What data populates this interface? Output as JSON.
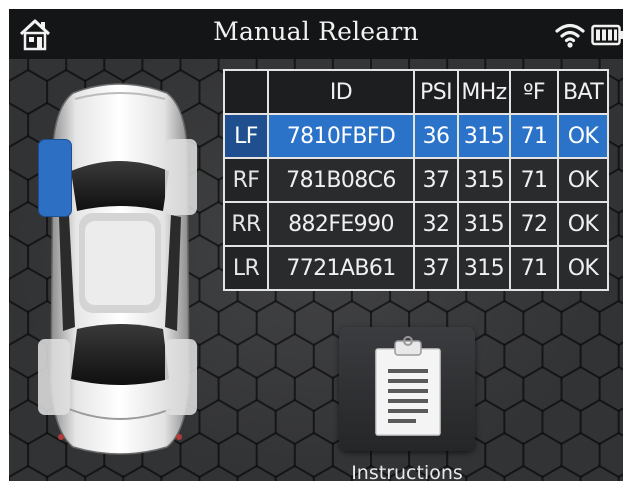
{
  "header": {
    "title": "Manual Relearn",
    "home_icon": "home-icon",
    "wifi_icon": "wifi-icon",
    "battery_icon": "battery-icon"
  },
  "car": {
    "icon": "car-top-view-icon",
    "selected_tire": "LF"
  },
  "sensor_table": {
    "headers": [
      "",
      "ID",
      "PSI",
      "MHz",
      "ºF",
      "BAT"
    ],
    "rows": [
      {
        "pos": "LF",
        "id": "7810FBFD",
        "psi": "36",
        "mhz": "315",
        "temp": "71",
        "bat": "OK"
      },
      {
        "pos": "RF",
        "id": "781B08C6",
        "psi": "37",
        "mhz": "315",
        "temp": "71",
        "bat": "OK"
      },
      {
        "pos": "RR",
        "id": "882FE990",
        "psi": "32",
        "mhz": "315",
        "temp": "72",
        "bat": "OK"
      },
      {
        "pos": "LR",
        "id": "7721AB61",
        "psi": "37",
        "mhz": "315",
        "temp": "71",
        "bat": "OK"
      }
    ]
  },
  "instructions": {
    "label": "Instructions",
    "icon": "clipboard-icon"
  },
  "colors": {
    "selected": "#2a73c8",
    "background": "#2e2f31",
    "header": "#141516"
  }
}
